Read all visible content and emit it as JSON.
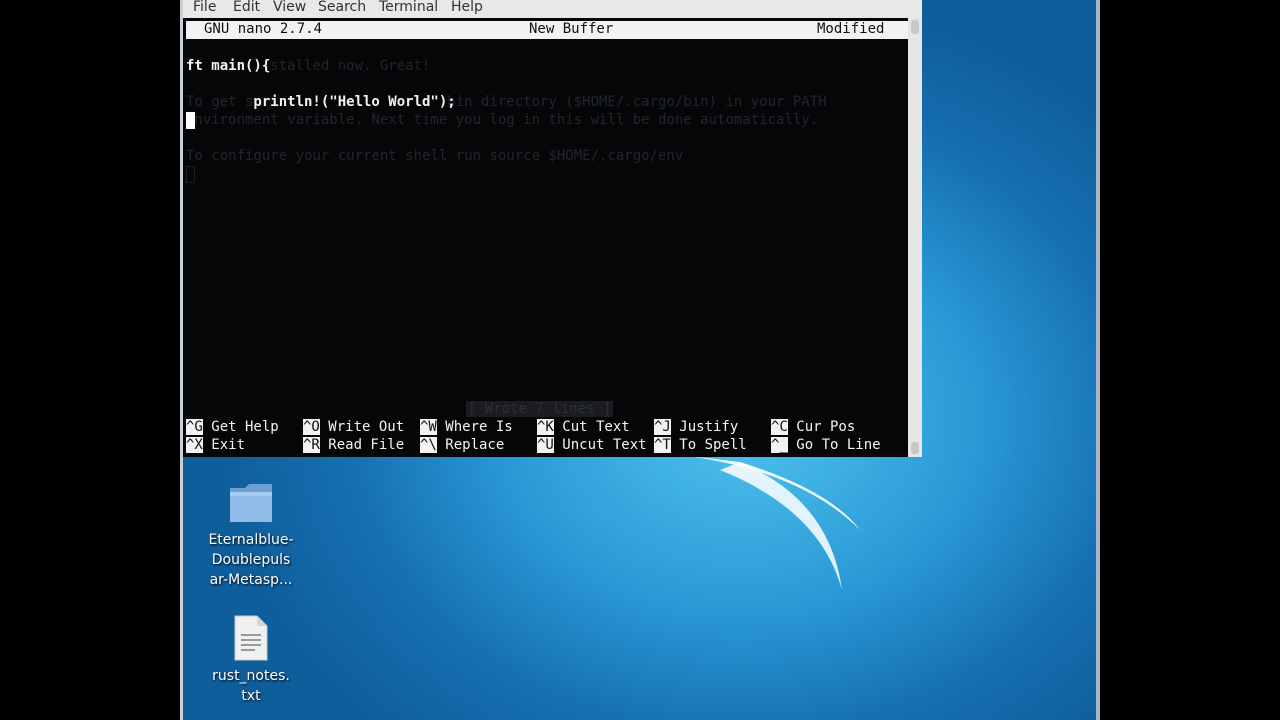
{
  "menubar": {
    "items": [
      "File",
      "Edit",
      "View",
      "Search",
      "Terminal",
      "Help"
    ]
  },
  "nano": {
    "version": "GNU nano 2.7.4",
    "buffer_name": "New Buffer",
    "state": "Modified"
  },
  "background_text": {
    "line1": "          stalled now. Great!",
    "line2": "To get s                       bin directory ($HOME/.cargo/bin) in your PATH",
    "line3": " nvironment variable. Next time you log in this will be done automatically.",
    "line4": "To configure your current shell run source $HOME/.cargo/env"
  },
  "editor": {
    "line1": "ft main(){",
    "line2": "        println!(\"Hello World\");"
  },
  "status_message": "[ Wrote 7 lines ]",
  "shortcuts": [
    {
      "key": "^G",
      "label": " Get Help"
    },
    {
      "key": "^O",
      "label": " Write Out"
    },
    {
      "key": "^W",
      "label": " Where Is"
    },
    {
      "key": "^K",
      "label": " Cut Text"
    },
    {
      "key": "^J",
      "label": " Justify"
    },
    {
      "key": "^C",
      "label": " Cur Pos"
    },
    {
      "key": "^X",
      "label": " Exit"
    },
    {
      "key": "^R",
      "label": " Read File"
    },
    {
      "key": "^\\",
      "label": " Replace"
    },
    {
      "key": "^U",
      "label": " Uncut Text"
    },
    {
      "key": "^T",
      "label": " To Spell"
    },
    {
      "key": "^_",
      "label": " Go To Line"
    }
  ],
  "desktop": {
    "icons": [
      {
        "name": "folder-icon",
        "label_lines": [
          "Eternalblue-",
          "Doublepuls",
          "ar-Metasp..."
        ]
      },
      {
        "name": "text-file-icon",
        "label_lines": [
          "rust_notes.",
          "txt"
        ]
      }
    ]
  },
  "colors": {
    "terminal_bg": "#050608",
    "desktop_blue": "#2a9ad6",
    "menubar_bg": "#e8e8e7"
  }
}
